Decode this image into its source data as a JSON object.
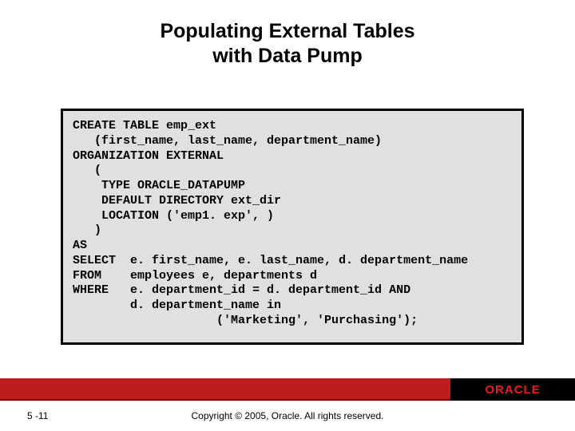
{
  "title": {
    "line1": "Populating External Tables",
    "line2": "with Data Pump"
  },
  "code": {
    "l1": "CREATE TABLE emp_ext",
    "l2": "   (first_name, last_name, department_name)",
    "l3": "ORGANIZATION EXTERNAL",
    "l4": "   (",
    "l5": "    TYPE ORACLE_DATAPUMP",
    "l6": "    DEFAULT DIRECTORY ext_dir",
    "l7": "    LOCATION ('emp1. exp', )",
    "l8": "   )",
    "l9": "AS",
    "l10": "SELECT  e. first_name, e. last_name, d. department_name",
    "l11": "FROM    employees e, departments d",
    "l12": "WHERE   e. department_id = d. department_id AND",
    "l13": "        d. department_name in",
    "l14": "                    ('Marketing', 'Purchasing');"
  },
  "footer": {
    "brand": "ORACLE",
    "page": "5 -11",
    "copyright": "Copyright © 2005, Oracle.  All rights reserved."
  }
}
